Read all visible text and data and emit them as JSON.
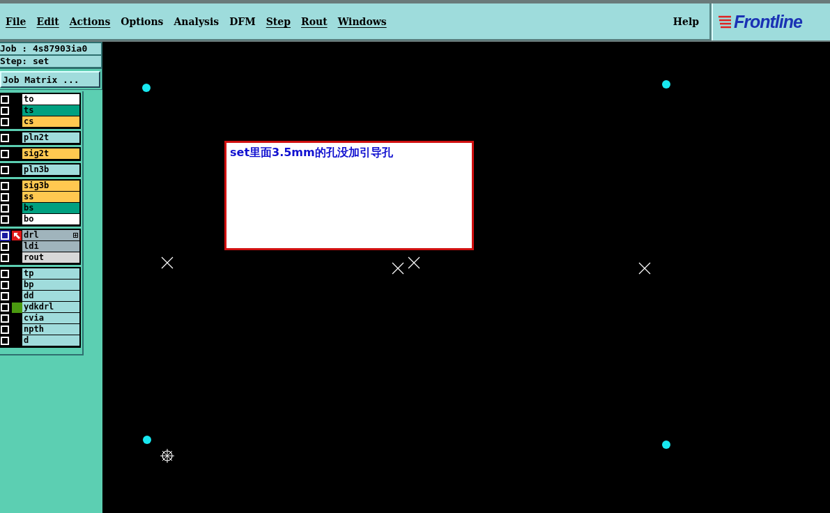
{
  "menu": {
    "items": [
      {
        "label": "File"
      },
      {
        "label": "Edit"
      },
      {
        "label": "Actions"
      },
      {
        "label": "Options"
      },
      {
        "label": "Analysis"
      },
      {
        "label": "DFM"
      },
      {
        "label": "Step"
      },
      {
        "label": "Rout"
      },
      {
        "label": "Windows"
      }
    ],
    "help": "Help",
    "logo": "Frontline"
  },
  "job": "Job : 4s87903ia0",
  "step": "Step: set",
  "job_matrix_button": "Job Matrix ...",
  "layer_groups": [
    [
      {
        "name": "to",
        "color": "#ffffff",
        "checked": false,
        "work": false,
        "displayed": false
      },
      {
        "name": "ts",
        "color": "#00a080",
        "checked": false,
        "work": false,
        "displayed": false
      },
      {
        "name": "cs",
        "color": "#ffc850",
        "checked": false,
        "work": false,
        "displayed": false
      }
    ],
    [
      {
        "name": "pln2t",
        "color": "#a0dcdc",
        "checked": false,
        "work": false,
        "displayed": false
      }
    ],
    [
      {
        "name": "sig2t",
        "color": "#ffc850",
        "checked": false,
        "work": false,
        "displayed": false
      }
    ],
    [
      {
        "name": "pln3b",
        "color": "#a0dcdc",
        "checked": false,
        "work": false,
        "displayed": false
      }
    ],
    [
      {
        "name": "sig3b",
        "color": "#ffc850",
        "checked": false,
        "work": false,
        "displayed": false
      },
      {
        "name": "ss",
        "color": "#ffc850",
        "checked": false,
        "work": false,
        "displayed": false
      },
      {
        "name": "bs",
        "color": "#00a080",
        "checked": false,
        "work": false,
        "displayed": false
      },
      {
        "name": "bo",
        "color": "#ffffff",
        "checked": false,
        "work": false,
        "displayed": false
      }
    ],
    [
      {
        "name": "drl",
        "color": "#a0b4bc",
        "checked": true,
        "work": true,
        "displayed": false
      },
      {
        "name": "ldi",
        "color": "#a0b4bc",
        "checked": false,
        "work": false,
        "displayed": false
      },
      {
        "name": "rout",
        "color": "#d8d8d8",
        "checked": false,
        "work": false,
        "displayed": false
      }
    ],
    [
      {
        "name": "tp",
        "color": "#a0dcdc",
        "checked": false,
        "work": false,
        "displayed": false
      },
      {
        "name": "bp",
        "color": "#a0dcdc",
        "checked": false,
        "work": false,
        "displayed": false
      },
      {
        "name": "dd",
        "color": "#a0dcdc",
        "checked": false,
        "work": false,
        "displayed": false
      },
      {
        "name": "ydkdrl",
        "color": "#a0dcdc",
        "checked": false,
        "work": false,
        "displayed": true
      },
      {
        "name": "cvia",
        "color": "#a0dcdc",
        "checked": false,
        "work": false,
        "displayed": false
      },
      {
        "name": "npth",
        "color": "#a0dcdc",
        "checked": false,
        "work": false,
        "displayed": false
      },
      {
        "name": "d",
        "color": "#a0dcdc",
        "checked": false,
        "work": false,
        "displayed": false
      }
    ]
  ],
  "note": "set里面3.5mm的孔没加引导孔"
}
